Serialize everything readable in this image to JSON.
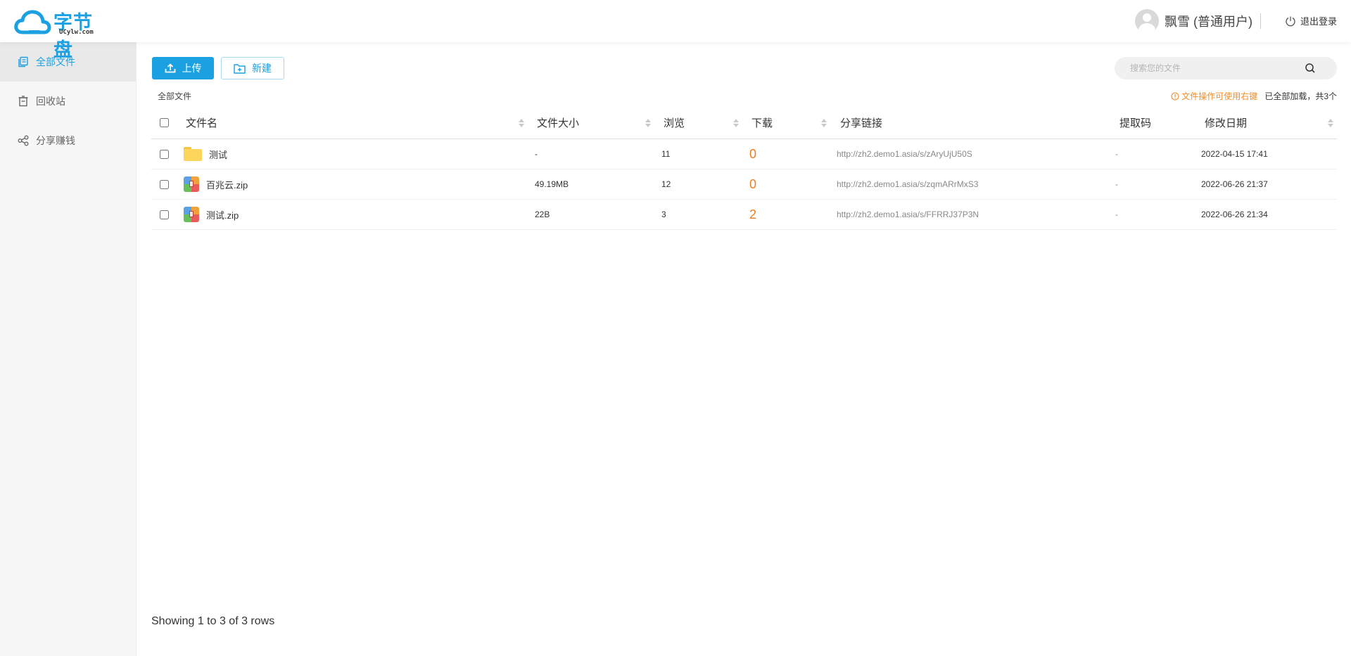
{
  "header": {
    "logo_text": "字节盘",
    "logo_sub": "UCylw.com",
    "user_name": "飘雪 (普通用户)",
    "logout_label": "退出登录"
  },
  "sidebar": {
    "items": [
      {
        "label": "全部文件",
        "icon": "files-icon",
        "active": true
      },
      {
        "label": "回收站",
        "icon": "trash-icon",
        "active": false
      },
      {
        "label": "分享赚钱",
        "icon": "share-icon",
        "active": false
      }
    ]
  },
  "toolbar": {
    "upload_label": "上传",
    "new_label": "新建"
  },
  "search": {
    "placeholder": "搜索您的文件"
  },
  "breadcrumb": "全部文件",
  "tip": {
    "warn_text": "文件操作可使用右键",
    "total_text": "已全部加载，共3个"
  },
  "table": {
    "columns": [
      "文件名",
      "文件大小",
      "浏览",
      "下载",
      "分享链接",
      "提取码",
      "修改日期"
    ],
    "rows": [
      {
        "type": "folder",
        "name": "测试",
        "size": "-",
        "views": "11",
        "downloads": "0",
        "link": "http://zh2.demo1.asia/s/zAryUjU50S",
        "code": "-",
        "date": "2022-04-15 17:41"
      },
      {
        "type": "zip",
        "name": "百兆云.zip",
        "size": "49.19MB",
        "views": "12",
        "downloads": "0",
        "link": "http://zh2.demo1.asia/s/zqmARrMxS3",
        "code": "-",
        "date": "2022-06-26 21:37"
      },
      {
        "type": "zip",
        "name": "测试.zip",
        "size": "22B",
        "views": "3",
        "downloads": "2",
        "link": "http://zh2.demo1.asia/s/FFRRJ37P3N",
        "code": "-",
        "date": "2022-06-26 21:34"
      }
    ]
  },
  "footer": {
    "pagination_text": "Showing 1 to 3 of 3 rows"
  },
  "colors": {
    "accent": "#1ba1e2",
    "download_count": "#f07c1c",
    "warning": "#f08c2c"
  }
}
